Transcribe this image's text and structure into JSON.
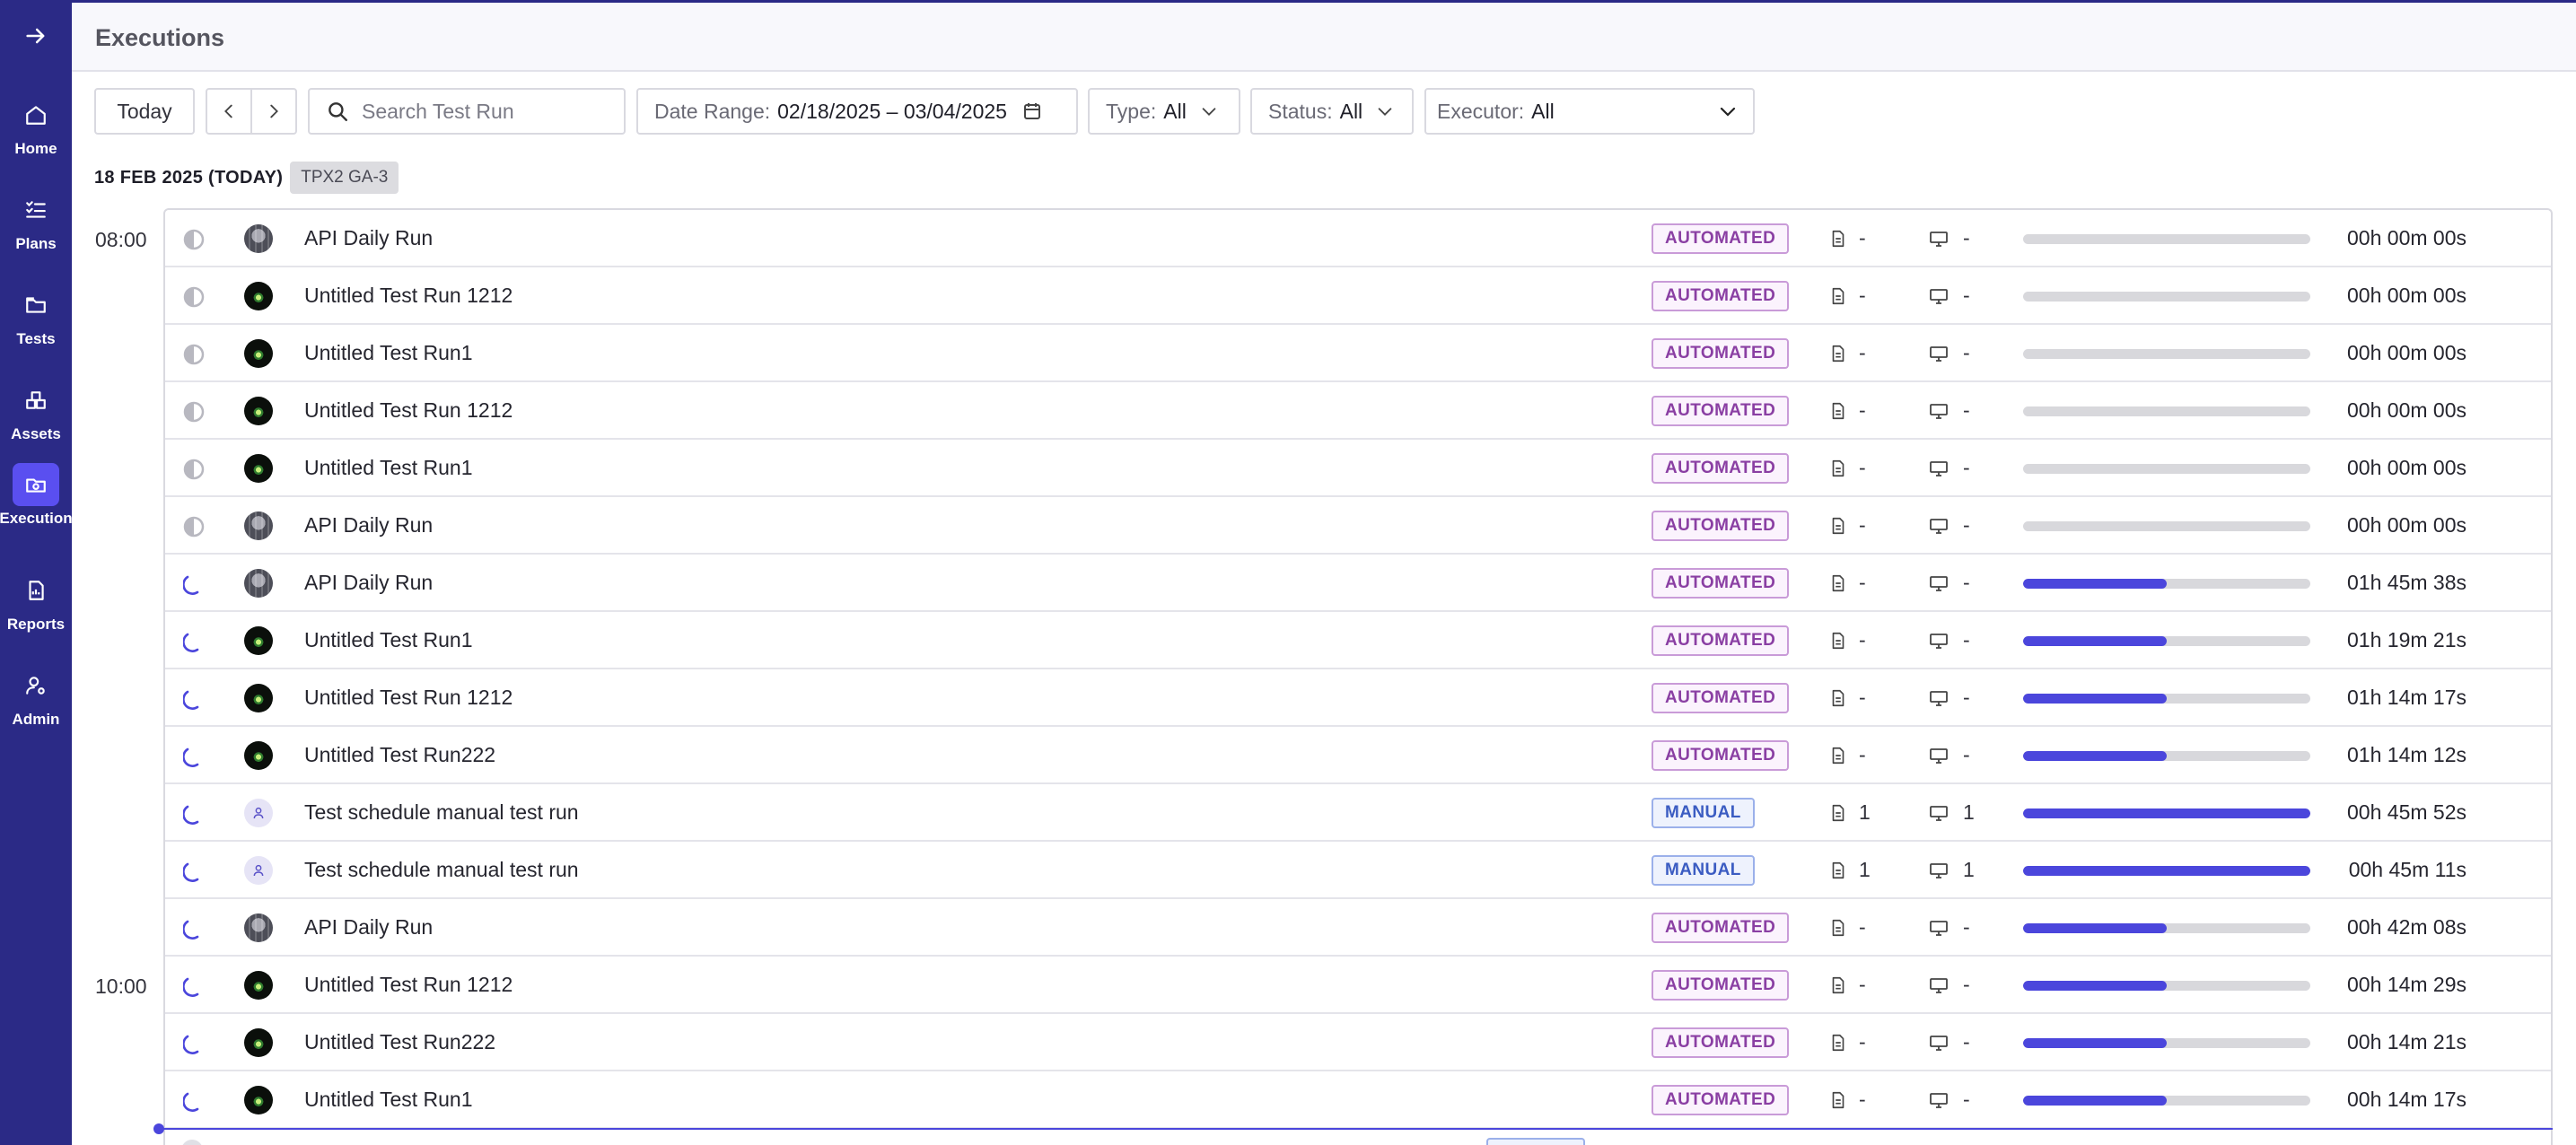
{
  "sidebar": {
    "items": [
      {
        "label": "Home",
        "icon": "home-icon"
      },
      {
        "label": "Plans",
        "icon": "plans-icon"
      },
      {
        "label": "Tests",
        "icon": "folder-icon"
      },
      {
        "label": "Assets",
        "icon": "assets-icon"
      },
      {
        "label": "Execution",
        "icon": "execution-icon",
        "active": true
      },
      {
        "label": "Reports",
        "icon": "report-icon"
      },
      {
        "label": "Admin",
        "icon": "admin-icon"
      }
    ]
  },
  "header": {
    "title": "Executions"
  },
  "toolbar": {
    "today_label": "Today",
    "search_placeholder": "Search Test Run",
    "date_range_label": "Date Range:",
    "date_range_value": "02/18/2025 – 03/04/2025",
    "type_label": "Type:",
    "type_value": "All",
    "status_label": "Status:",
    "status_value": "All",
    "executor_label": "Executor:",
    "executor_value": "All"
  },
  "date_group": {
    "date": "18 FEB 2025 (TODAY)",
    "tag": "TPX2 GA-3"
  },
  "time_labels": [
    "08:00",
    "10:00"
  ],
  "colors": {
    "sidebar": "#2b2a86",
    "accent": "#4b46dc",
    "automated": "#8a3fa3",
    "manual": "#3b5cc2"
  },
  "runs": [
    {
      "status": "pending",
      "avatar": "photo",
      "name": "API Daily Run",
      "type": "AUTOMATED",
      "tests": "-",
      "devices": "-",
      "progress": 0,
      "duration": "00h 00m 00s"
    },
    {
      "status": "pending",
      "avatar": "dark",
      "name": "Untitled Test Run 1212",
      "type": "AUTOMATED",
      "tests": "-",
      "devices": "-",
      "progress": 0,
      "duration": "00h 00m 00s"
    },
    {
      "status": "pending",
      "avatar": "dark",
      "name": "Untitled Test Run1",
      "type": "AUTOMATED",
      "tests": "-",
      "devices": "-",
      "progress": 0,
      "duration": "00h 00m 00s"
    },
    {
      "status": "pending",
      "avatar": "dark",
      "name": "Untitled Test Run 1212",
      "type": "AUTOMATED",
      "tests": "-",
      "devices": "-",
      "progress": 0,
      "duration": "00h 00m 00s"
    },
    {
      "status": "pending",
      "avatar": "dark",
      "name": "Untitled Test Run1",
      "type": "AUTOMATED",
      "tests": "-",
      "devices": "-",
      "progress": 0,
      "duration": "00h 00m 00s"
    },
    {
      "status": "pending",
      "avatar": "photo",
      "name": "API Daily Run",
      "type": "AUTOMATED",
      "tests": "-",
      "devices": "-",
      "progress": 0,
      "duration": "00h 00m 00s"
    },
    {
      "status": "running",
      "avatar": "photo",
      "name": "API Daily Run",
      "type": "AUTOMATED",
      "tests": "-",
      "devices": "-",
      "progress": 50,
      "duration": "01h 45m 38s"
    },
    {
      "status": "running",
      "avatar": "dark",
      "name": "Untitled Test Run1",
      "type": "AUTOMATED",
      "tests": "-",
      "devices": "-",
      "progress": 50,
      "duration": "01h 19m 21s"
    },
    {
      "status": "running",
      "avatar": "dark",
      "name": "Untitled Test Run 1212",
      "type": "AUTOMATED",
      "tests": "-",
      "devices": "-",
      "progress": 50,
      "duration": "01h 14m 17s"
    },
    {
      "status": "running",
      "avatar": "dark",
      "name": "Untitled Test Run222",
      "type": "AUTOMATED",
      "tests": "-",
      "devices": "-",
      "progress": 50,
      "duration": "01h 14m 12s"
    },
    {
      "status": "running",
      "avatar": "user",
      "name": "Test schedule manual test run",
      "type": "MANUAL",
      "tests": "1",
      "devices": "1",
      "progress": 100,
      "duration": "00h 45m 52s"
    },
    {
      "status": "running",
      "avatar": "user",
      "name": "Test schedule manual test run",
      "type": "MANUAL",
      "tests": "1",
      "devices": "1",
      "progress": 100,
      "duration": "00h 45m 11s"
    },
    {
      "status": "running",
      "avatar": "photo",
      "name": "API Daily Run",
      "type": "AUTOMATED",
      "tests": "-",
      "devices": "-",
      "progress": 50,
      "duration": "00h 42m 08s"
    },
    {
      "status": "running",
      "avatar": "dark",
      "name": "Untitled Test Run 1212",
      "type": "AUTOMATED",
      "tests": "-",
      "devices": "-",
      "progress": 50,
      "duration": "00h 14m 29s"
    },
    {
      "status": "running",
      "avatar": "dark",
      "name": "Untitled Test Run222",
      "type": "AUTOMATED",
      "tests": "-",
      "devices": "-",
      "progress": 50,
      "duration": "00h 14m 21s"
    },
    {
      "status": "running",
      "avatar": "dark",
      "name": "Untitled Test Run1",
      "type": "AUTOMATED",
      "tests": "-",
      "devices": "-",
      "progress": 50,
      "duration": "00h 14m 17s"
    }
  ]
}
